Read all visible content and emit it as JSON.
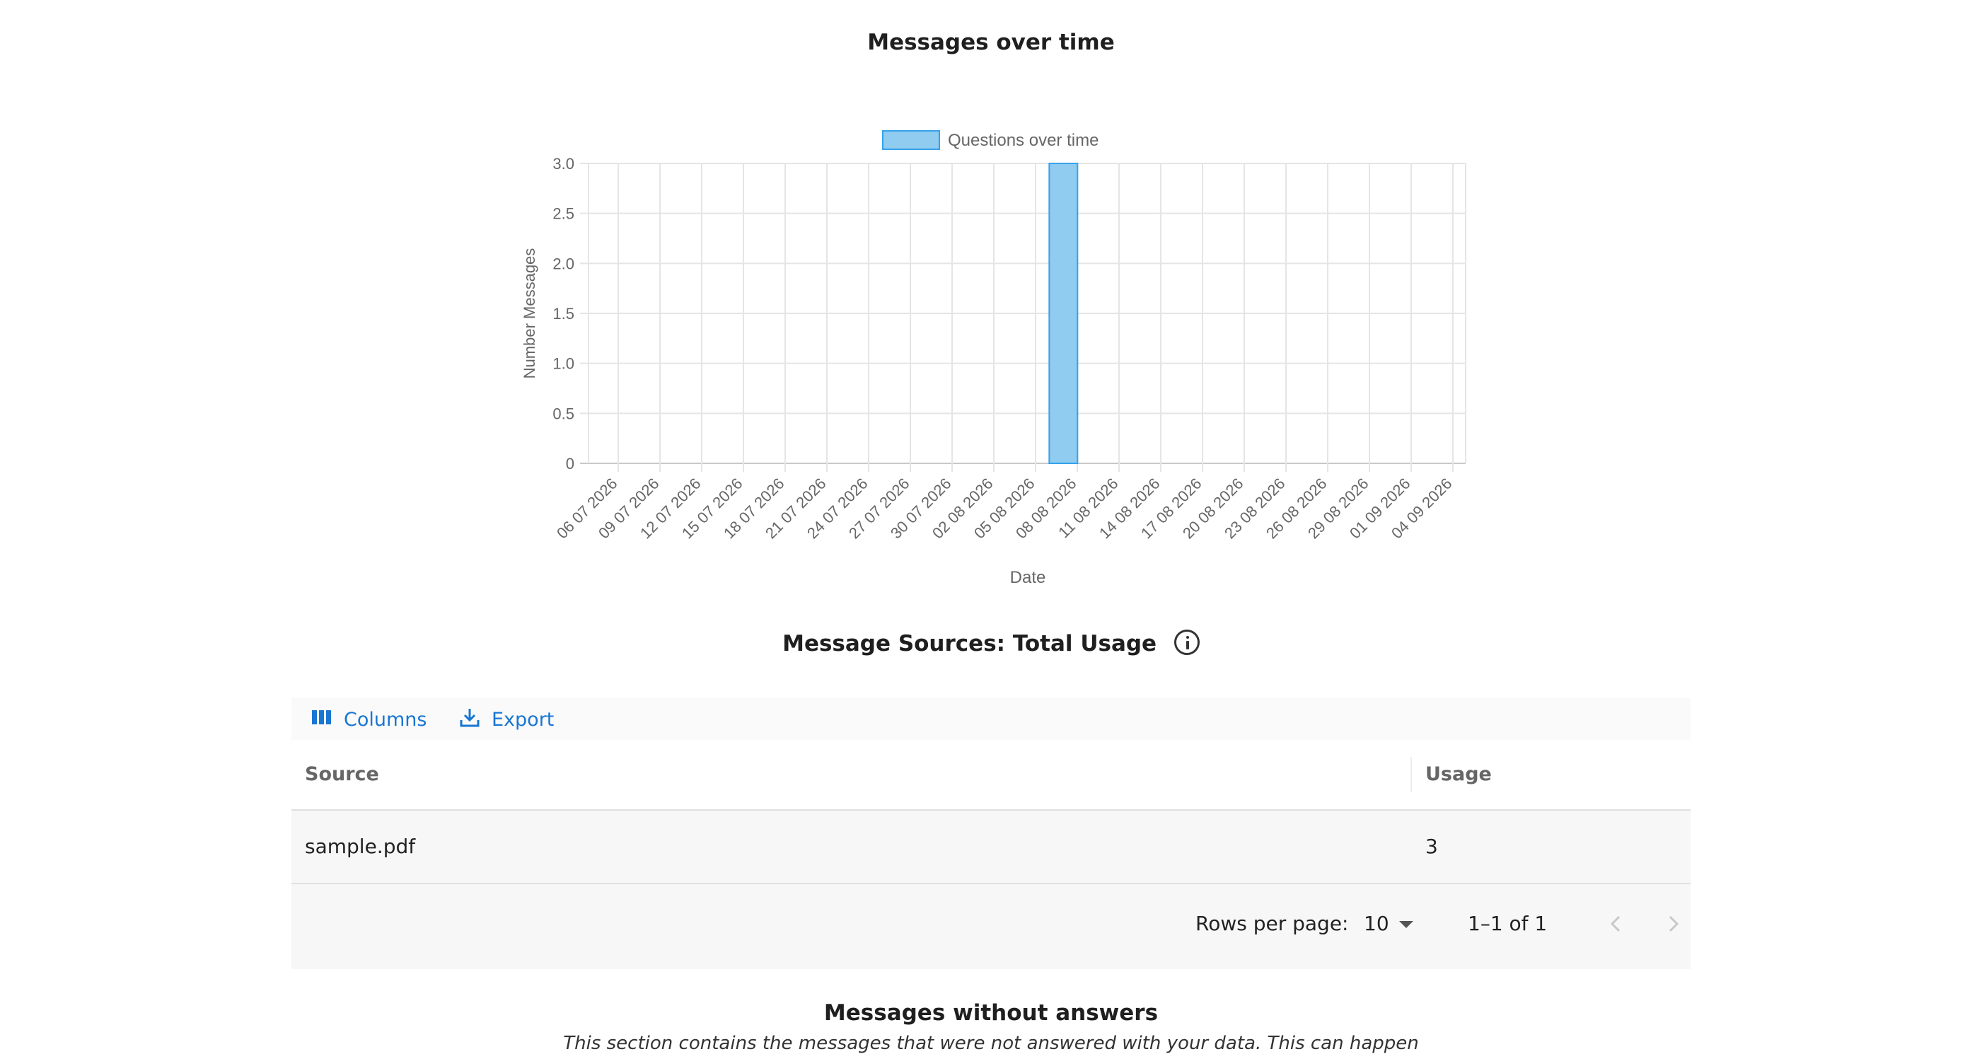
{
  "chart": {
    "title": "Messages over time"
  },
  "chart_data": {
    "type": "bar",
    "title": "Messages over time",
    "xlabel": "Date",
    "ylabel": "Number Messages",
    "ylim": [
      0,
      3
    ],
    "y_ticks": [
      "0",
      "0.5",
      "1.0",
      "1.5",
      "2.0",
      "2.5",
      "3.0"
    ],
    "grid": true,
    "legend": "top",
    "categories": [
      "06 07 2026",
      "09 07 2026",
      "12 07 2026",
      "15 07 2026",
      "18 07 2026",
      "21 07 2026",
      "24 07 2026",
      "27 07 2026",
      "30 07 2026",
      "02 08 2026",
      "05 08 2026",
      "08 08 2026",
      "11 08 2026",
      "14 08 2026",
      "17 08 2026",
      "20 08 2026",
      "23 08 2026",
      "26 08 2026",
      "29 08 2026",
      "01 09 2026",
      "04 09 2026"
    ],
    "series": [
      {
        "name": "Questions over time",
        "color": "#90cbf0",
        "border_color": "#36a2eb",
        "points": [
          {
            "x": "07 08 2026",
            "y": 3
          }
        ]
      }
    ]
  },
  "sources": {
    "title": "Message Sources: Total Usage",
    "toolbar": {
      "columns_label": "Columns",
      "export_label": "Export"
    },
    "headers": {
      "source": "Source",
      "usage": "Usage"
    },
    "rows": [
      {
        "source": "sample.pdf",
        "usage": "3"
      }
    ],
    "footer": {
      "rows_per_page_label": "Rows per page:",
      "rows_per_page_value": "10",
      "range": "1–1 of 1"
    }
  },
  "missing": {
    "title": "Messages without answers",
    "description": "This section contains the messages that were not answered with your data. This can happen"
  }
}
